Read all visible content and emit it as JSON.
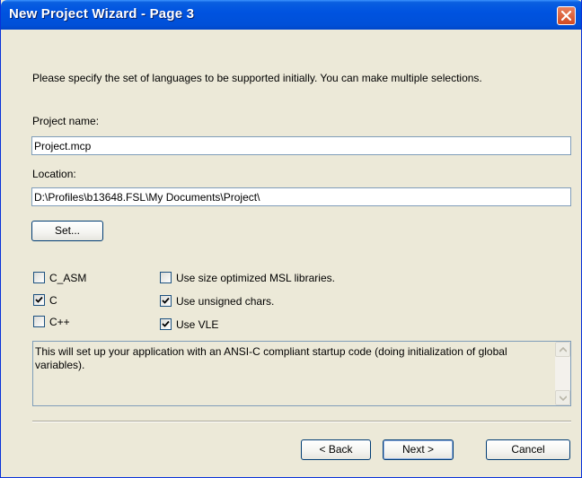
{
  "window": {
    "title": "New Project Wizard - Page  3"
  },
  "instructions": "Please specify the set of languages to be supported initially. You can make multiple selections.",
  "project_name": {
    "label": "Project name:",
    "value": "Project.mcp"
  },
  "location": {
    "label": "Location:",
    "value": "D:\\Profiles\\b13648.FSL\\My Documents\\Project\\"
  },
  "set_button": "Set...",
  "languages": [
    {
      "label": "C_ASM",
      "checked": false
    },
    {
      "label": "C",
      "checked": true
    },
    {
      "label": "C++",
      "checked": false
    }
  ],
  "options": [
    {
      "label": "Use size optimized MSL libraries.",
      "checked": false
    },
    {
      "label": "Use unsigned chars.",
      "checked": true
    },
    {
      "label": "Use VLE",
      "checked": true
    }
  ],
  "description": "This will set up your application with an ANSI-C compliant startup code (doing initialization of global variables).",
  "buttons": {
    "back": "< Back",
    "next": "Next >",
    "cancel": "Cancel"
  },
  "icons": {
    "close": "close-x-icon",
    "check": "check-mark-icon",
    "scroll_up": "scroll-up-arrow-icon",
    "scroll_down": "scroll-down-arrow-icon"
  },
  "colors": {
    "title_bar": "#0053e0",
    "dialog_bg": "#ece9d8",
    "close_button": "#d24a22",
    "field_border": "#7f9db9"
  }
}
